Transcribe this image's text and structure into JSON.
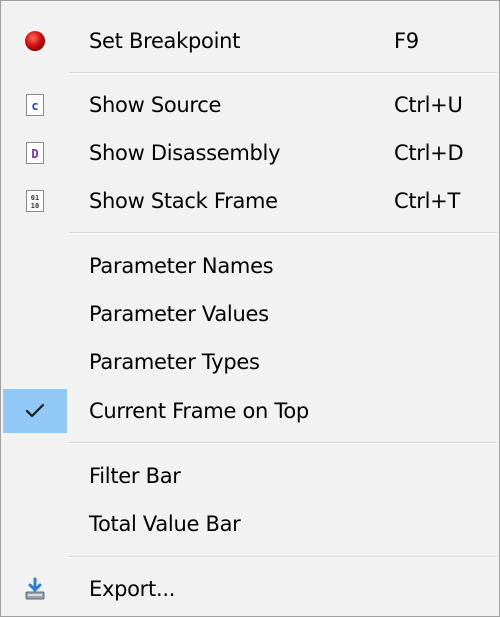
{
  "menu": {
    "items": [
      {
        "label": "Set Breakpoint",
        "shortcut": "F9",
        "icon": "red-dot-icon"
      },
      {
        "label": "Show Source",
        "shortcut": "Ctrl+U",
        "icon": "c-file-icon",
        "glyph": "c"
      },
      {
        "label": "Show Disassembly",
        "shortcut": "Ctrl+D",
        "icon": "d-file-icon",
        "glyph": "D"
      },
      {
        "label": "Show Stack Frame",
        "shortcut": "Ctrl+T",
        "icon": "binary-file-icon",
        "glyph": "01\n10"
      },
      {
        "label": "Parameter Names"
      },
      {
        "label": "Parameter Values"
      },
      {
        "label": "Parameter Types"
      },
      {
        "label": "Current Frame on Top",
        "checked": true,
        "icon": "checkmark-icon"
      },
      {
        "label": "Filter Bar"
      },
      {
        "label": "Total Value Bar"
      },
      {
        "label": "Export...",
        "icon": "export-icon"
      }
    ]
  },
  "colors": {
    "menu_background": "#f2f2f2",
    "check_highlight": "#90c8f6",
    "breakpoint_red": "#d01010",
    "separator": "#d4d4d4"
  }
}
